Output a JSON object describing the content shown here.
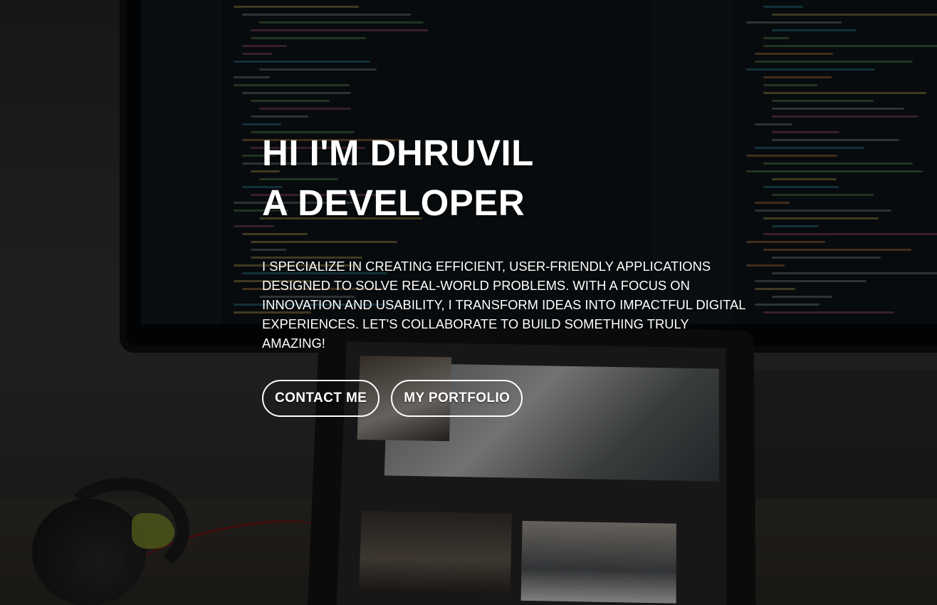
{
  "hero": {
    "title_line1": "HI I'M DHRUVIL",
    "title_line2": "A DEVELOPER",
    "description": "I SPECIALIZE IN CREATING EFFICIENT, USER-FRIENDLY APPLICATIONS DESIGNED TO SOLVE REAL-WORLD PROBLEMS. WITH A FOCUS ON INNOVATION AND USABILITY, I TRANSFORM IDEAS INTO IMPACTFUL DIGITAL EXPERIENCES. LET'S COLLABORATE TO BUILD SOMETHING TRULY AMAZING!",
    "buttons": {
      "contact_label": "CONTACT ME",
      "portfolio_label": "MY PORTFOLIO"
    }
  },
  "colors": {
    "text": "#ffffff",
    "button_border": "#ffffff",
    "background_overlay": "#000000"
  }
}
